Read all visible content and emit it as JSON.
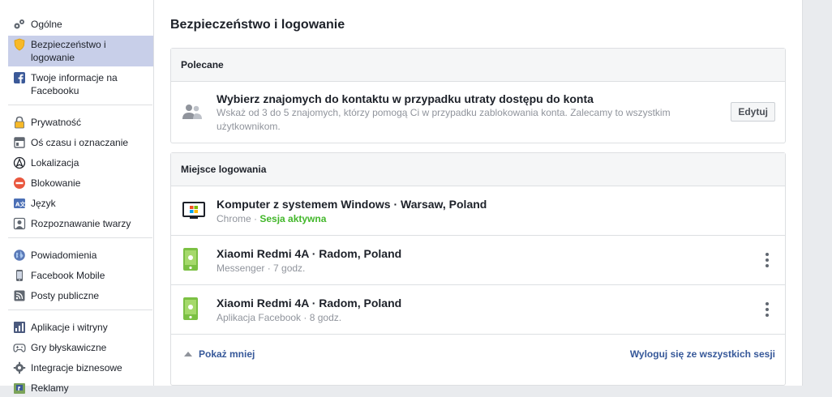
{
  "sidebar": {
    "group1": [
      {
        "label": "Ogólne",
        "icon": "gears-icon"
      },
      {
        "label": "Bezpieczeństwo i logowanie",
        "icon": "shield-icon",
        "active": true
      },
      {
        "label": "Twoje informacje na Facebooku",
        "icon": "facebook-icon"
      }
    ],
    "group2": [
      {
        "label": "Prywatność",
        "icon": "lock-icon"
      },
      {
        "label": "Oś czasu i oznaczanie",
        "icon": "timeline-icon"
      },
      {
        "label": "Lokalizacja",
        "icon": "location-icon"
      },
      {
        "label": "Blokowanie",
        "icon": "block-icon"
      },
      {
        "label": "Język",
        "icon": "language-icon"
      },
      {
        "label": "Rozpoznawanie twarzy",
        "icon": "face-recognition-icon"
      }
    ],
    "group3": [
      {
        "label": "Powiadomienia",
        "icon": "globe-icon"
      },
      {
        "label": "Facebook Mobile",
        "icon": "mobile-icon"
      },
      {
        "label": "Posty publiczne",
        "icon": "rss-icon"
      }
    ],
    "group4": [
      {
        "label": "Aplikacje i witryny",
        "icon": "apps-icon"
      },
      {
        "label": "Gry błyskawiczne",
        "icon": "gamepad-icon"
      },
      {
        "label": "Integracje biznesowe",
        "icon": "gear-icon"
      },
      {
        "label": "Reklamy",
        "icon": "ads-icon"
      }
    ]
  },
  "main": {
    "title": "Bezpieczeństwo i logowanie",
    "recommended": {
      "header": "Polecane",
      "item_title": "Wybierz znajomych do kontaktu w przypadku utraty dostępu do konta",
      "item_desc": "Wskaż od 3 do 5 znajomych, którzy pomogą Ci w przypadku zablokowania konta. Zalecamy to wszystkim użytkownikom.",
      "edit_label": "Edytuj"
    },
    "login_places": {
      "header": "Miejsce logowania",
      "sessions": [
        {
          "device": "Komputer z systemem Windows · Warsaw, Poland",
          "app": "Chrome · ",
          "status": "Sesja aktywna",
          "icon": "windows-pc-icon"
        },
        {
          "device": "Xiaomi Redmi 4A · Radom, Poland",
          "app": "Messenger · 7 godz.",
          "status": "",
          "icon": "phone-icon"
        },
        {
          "device": "Xiaomi Redmi 4A · Radom, Poland",
          "app": "Aplikacja Facebook · 8 godz.",
          "status": "",
          "icon": "phone-icon"
        }
      ],
      "show_less": "Pokaż mniej",
      "logout_all": "Wyloguj się ze wszystkich sesji"
    }
  }
}
